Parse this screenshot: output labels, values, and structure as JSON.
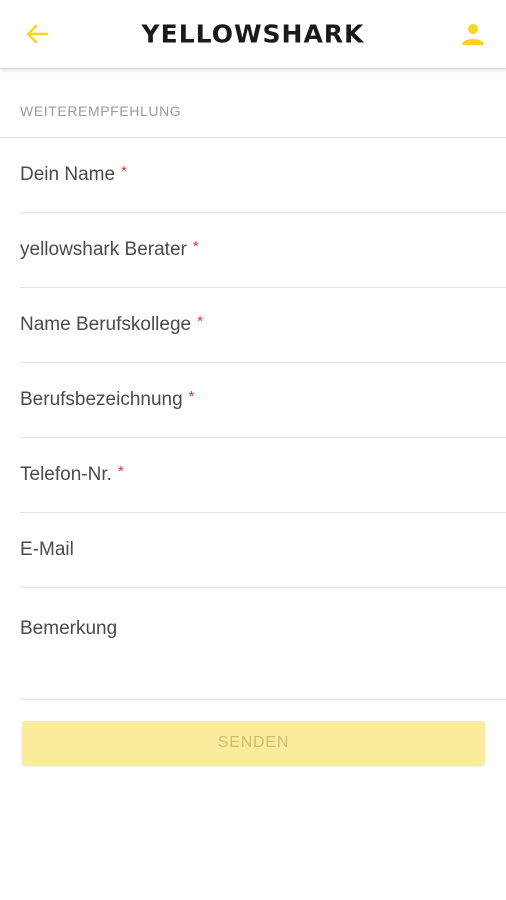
{
  "header": {
    "logo": "YELLOWSHARK",
    "back_icon": "arrow-left-icon",
    "user_icon": "user-icon",
    "accent_color": "#f7d51d"
  },
  "form": {
    "section_title": "WEITEREMPFEHLUNG",
    "fields": [
      {
        "label": "Dein Name",
        "required_mark": "*"
      },
      {
        "label": "yellowshark Berater",
        "required_mark": "*"
      },
      {
        "label": "Name Berufskollege",
        "required_mark": "*"
      },
      {
        "label": "Berufsbezeichnung",
        "required_mark": "*"
      },
      {
        "label": "Telefon-Nr.",
        "required_mark": "*"
      },
      {
        "label": "E-Mail"
      },
      {
        "label": "Bemerkung"
      }
    ],
    "submit_label": "SENDEN"
  }
}
